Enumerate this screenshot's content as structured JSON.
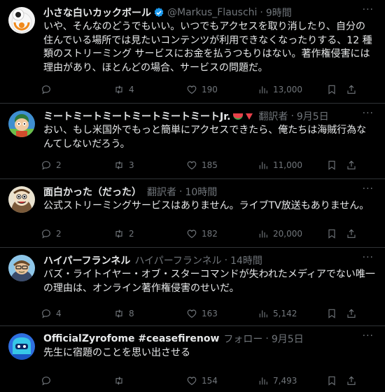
{
  "tweets": [
    {
      "name": "小さな白いカックボール",
      "handle": "@Markus_Flauschi",
      "sep": "·",
      "time": "9時間",
      "text": "いや、そんなのどうでもいい。いつでもアクセスを取り消したり、自分の住んでいる場所では見たいコンテンツが利用できなくなったりする、12 種類のストリーミング サービスにお金を払うつもりはない。著作権侵害には理由があり、ほとんどの場合、サービスの問題だ。",
      "replies": "",
      "retweets": "4",
      "likes": "190",
      "views": "13,000"
    },
    {
      "name": "ミートミートミートミートミートミートJr.",
      "handle": "翻訳者",
      "sep": "·",
      "time": "9月5日",
      "text": "おい、もし米国外でもっと簡単にアクセスできたら、俺たちは海賊行為なんてしないだろう。",
      "replies": "2",
      "retweets": "3",
      "likes": "185",
      "views": "11,000"
    },
    {
      "name": "面白かった（だった）",
      "handle": "翻訳者",
      "sep": "·",
      "time": "10時間",
      "text": "公式ストリーミングサービスはありません。ライブTV放送もありません。",
      "replies": "2",
      "retweets": "2",
      "likes": "182",
      "views": "20,000"
    },
    {
      "name": "ハイパーフランネル",
      "handle": "ハイパーフランネル",
      "sep": "·",
      "time": "14時間",
      "text": "バズ・ライトイヤー・オブ・スターコマンドが失われたメディアでない唯一の理由は、オンライン著作権侵害のせいだ。",
      "replies": "4",
      "retweets": "8",
      "likes": "163",
      "views": "5,142"
    },
    {
      "name": "OfficialZyrofome #ceasefirenow",
      "handle": "フォロー",
      "sep": "·",
      "time": "9月5日",
      "text": "先生に宿題のことを思い出させる",
      "replies": "",
      "retweets": "",
      "likes": "154",
      "views": "7,493"
    }
  ],
  "icons": {
    "more": "more-icon",
    "reply": "reply-icon",
    "retweet": "retweet-icon",
    "like": "heart-icon",
    "views": "views-icon",
    "bookmark": "bookmark-icon",
    "share": "share-icon"
  },
  "colors": {
    "background": "#000000",
    "text": "#e7e9ea",
    "muted": "#71767b",
    "divider": "#2f3336",
    "verified": "#1d9bf0"
  }
}
